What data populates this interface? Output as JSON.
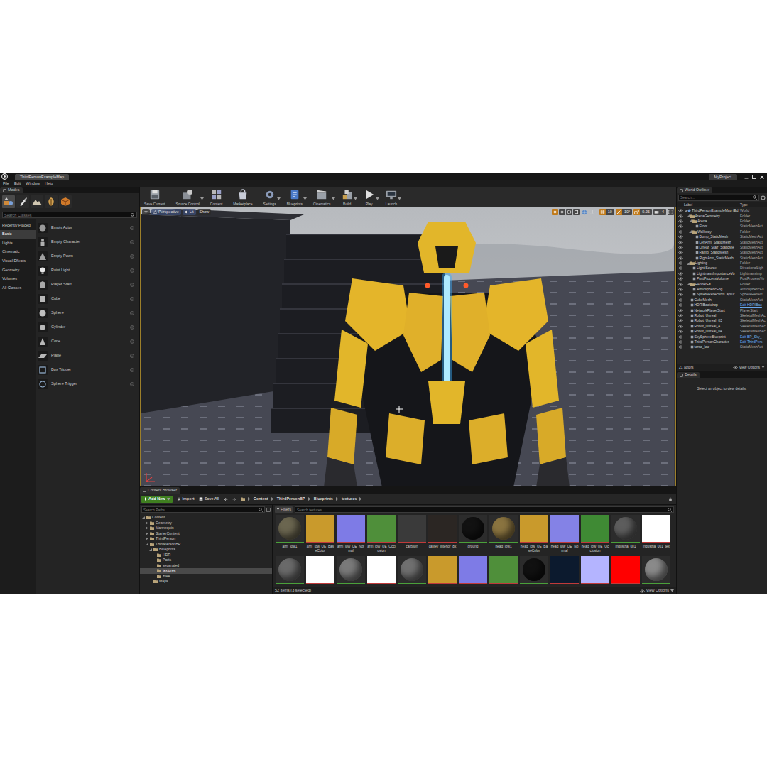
{
  "window": {
    "tab": "ThirdPersonExampleMap",
    "project": "MyProject"
  },
  "menu": [
    "File",
    "Edit",
    "Window",
    "Help"
  ],
  "modes": {
    "title": "Modes",
    "tools": [
      {
        "selected": true
      },
      {
        "selected": false
      },
      {
        "selected": false
      },
      {
        "selected": false
      },
      {
        "selected": false
      }
    ],
    "search": {
      "placeholder": "Search Classes"
    },
    "categories": [
      {
        "label": "Recently Placed",
        "selected": false
      },
      {
        "label": "Basic",
        "selected": true
      },
      {
        "label": "Lights",
        "selected": false
      },
      {
        "label": "Cinematic",
        "selected": false
      },
      {
        "label": "Visual Effects",
        "selected": false
      },
      {
        "label": "Geometry",
        "selected": false
      },
      {
        "label": "Volumes",
        "selected": false
      },
      {
        "label": "All Classes",
        "selected": false
      }
    ],
    "items": [
      "Empty Actor",
      "Empty Character",
      "Empty Pawn",
      "Point Light",
      "Player Start",
      "Cube",
      "Sphere",
      "Cylinder",
      "Cone",
      "Plane",
      "Box Trigger",
      "Sphere Trigger"
    ]
  },
  "toolbar": [
    {
      "label": "Save Current",
      "dropdown": false
    },
    {
      "label": "Source Control",
      "dropdown": true
    },
    {
      "label": "Content",
      "dropdown": false
    },
    {
      "label": "Marketplace",
      "dropdown": false
    },
    {
      "label": "Settings",
      "dropdown": true
    },
    {
      "label": "Blueprints",
      "dropdown": true
    },
    {
      "label": "Cinematics",
      "dropdown": true
    },
    {
      "label": "Build",
      "dropdown": true
    },
    {
      "label": "Play",
      "dropdown": true
    },
    {
      "label": "Launch",
      "dropdown": true
    }
  ],
  "viewport": {
    "view": "Perspective",
    "lighting": "Lit",
    "show": "Show",
    "transform_tools": [
      {
        "selected": true
      },
      {
        "selected": false
      },
      {
        "selected": false
      },
      {
        "selected": false
      }
    ],
    "snaps": [
      {
        "value": "10",
        "enabled": true
      },
      {
        "value": "10°",
        "enabled": true
      },
      {
        "value": "0.25",
        "enabled": true
      }
    ],
    "camera_speed": "4"
  },
  "outliner": {
    "title": "World Outliner",
    "search": {
      "placeholder": "Search..."
    },
    "columns": [
      "Label",
      "Type"
    ],
    "tree": [
      {
        "label": "ThirdPersonExampleMap (Ed",
        "type": "World",
        "kind": "world",
        "link": false,
        "expanded": true,
        "children": [
          {
            "label": "ArenaGeometry",
            "type": "Folder",
            "kind": "folder",
            "link": false,
            "expanded": true,
            "children": [
              {
                "label": "Arena",
                "type": "Folder",
                "kind": "folder",
                "link": false,
                "expanded": true,
                "children": [
                  {
                    "label": "Floor",
                    "type": "StaticMeshAct",
                    "kind": "actor",
                    "link": false,
                    "expanded": false,
                    "children": []
                  }
                ]
              },
              {
                "label": "Walkway",
                "type": "Folder",
                "kind": "folder",
                "link": false,
                "expanded": true,
                "children": [
                  {
                    "label": "Bump_StaticMesh",
                    "type": "StaticMeshAct",
                    "kind": "actor",
                    "link": false,
                    "expanded": false,
                    "children": []
                  },
                  {
                    "label": "LeftArm_StaticMesh",
                    "type": "StaticMeshAct",
                    "kind": "actor",
                    "link": false,
                    "expanded": false,
                    "children": []
                  },
                  {
                    "label": "Linear_Stair_StaticMe",
                    "type": "StaticMeshAct",
                    "kind": "actor",
                    "link": false,
                    "expanded": false,
                    "children": []
                  },
                  {
                    "label": "Ramp_StaticMesh",
                    "type": "StaticMeshAct",
                    "kind": "actor",
                    "link": false,
                    "expanded": false,
                    "children": []
                  },
                  {
                    "label": "RightArm_StaticMesh",
                    "type": "StaticMeshAct",
                    "kind": "actor",
                    "link": false,
                    "expanded": false,
                    "children": []
                  }
                ]
              }
            ]
          },
          {
            "label": "Lighting",
            "type": "Folder",
            "kind": "folder",
            "link": false,
            "expanded": true,
            "children": [
              {
                "label": "Light Source",
                "type": "DirectionalLigh",
                "kind": "actor",
                "link": false,
                "expanded": false,
                "children": []
              },
              {
                "label": "LightmassImportanceVo",
                "type": "Lightmassimp",
                "kind": "actor",
                "link": false,
                "expanded": false,
                "children": []
              },
              {
                "label": "PostProcessVolume",
                "type": "PostProcessVo",
                "kind": "actor",
                "link": false,
                "expanded": false,
                "children": []
              }
            ]
          },
          {
            "label": "RenderFX",
            "type": "Folder",
            "kind": "folder",
            "link": false,
            "expanded": true,
            "children": [
              {
                "label": "AtmosphericFog",
                "type": "AtmosphericFo",
                "kind": "actor",
                "link": false,
                "expanded": false,
                "children": []
              },
              {
                "label": "SphereReflectionCaptur",
                "type": "SphereReflect",
                "kind": "actor",
                "link": false,
                "expanded": false,
                "children": []
              }
            ]
          },
          {
            "label": "CubeMesh",
            "type": "StaticMeshAct",
            "kind": "actor",
            "link": false,
            "expanded": false,
            "children": []
          },
          {
            "label": "HDRIBackdrop",
            "type": "Edit HDRIBac",
            "kind": "actor",
            "link": true,
            "expanded": false,
            "children": []
          },
          {
            "label": "NetworkPlayerStart",
            "type": "PlayerStart",
            "kind": "actor",
            "link": false,
            "expanded": false,
            "children": []
          },
          {
            "label": "Robot_Unreal",
            "type": "SkeletalMeshAc",
            "kind": "actor",
            "link": false,
            "expanded": false,
            "children": []
          },
          {
            "label": "Robot_Unreal_03",
            "type": "SkeletalMeshAc",
            "kind": "actor",
            "link": false,
            "expanded": false,
            "children": []
          },
          {
            "label": "Robot_Unreal_4",
            "type": "SkeletalMeshAc",
            "kind": "actor",
            "link": false,
            "expanded": false,
            "children": []
          },
          {
            "label": "Robot_Unreal_04",
            "type": "SkeletalMeshAc",
            "kind": "actor",
            "link": false,
            "expanded": false,
            "children": []
          },
          {
            "label": "SkySphereBlueprint",
            "type": "Edit BP_Sky_",
            "kind": "actor",
            "link": true,
            "expanded": false,
            "children": []
          },
          {
            "label": "ThirdPersonCharacter",
            "type": "Edit ThirdPers",
            "kind": "actor",
            "link": true,
            "expanded": false,
            "children": []
          },
          {
            "label": "torso_low",
            "type": "StaticMeshAct",
            "kind": "actor",
            "link": false,
            "expanded": false,
            "children": []
          }
        ]
      }
    ],
    "footer": "21 actors",
    "view_options": "View Options"
  },
  "details": {
    "title": "Details",
    "empty": "Select an object to view details."
  },
  "content_browser": {
    "title": "Content Browser",
    "add_new": "Add New",
    "import": "Import",
    "save_all": "Save All",
    "path": [
      "Content",
      "ThirdPersonBP",
      "Blueprints",
      "textures"
    ],
    "search_paths": {
      "placeholder": "Search Paths"
    },
    "folders": [
      {
        "label": "Content",
        "expandable": true,
        "expanded": true,
        "selected": false,
        "children": [
          {
            "label": "Geometry",
            "expandable": true,
            "expanded": false,
            "selected": false,
            "children": []
          },
          {
            "label": "Mannequin",
            "expandable": true,
            "expanded": false,
            "selected": false,
            "children": []
          },
          {
            "label": "StarterContent",
            "expandable": true,
            "expanded": false,
            "selected": false,
            "children": []
          },
          {
            "label": "ThirdPerson",
            "expandable": true,
            "expanded": false,
            "selected": false,
            "children": []
          },
          {
            "label": "ThirdPersonBP",
            "expandable": true,
            "expanded": true,
            "selected": false,
            "children": [
              {
                "label": "Blueprints",
                "expandable": true,
                "expanded": true,
                "selected": false,
                "children": [
                  {
                    "label": "HDR",
                    "expandable": false,
                    "expanded": false,
                    "selected": false,
                    "children": []
                  },
                  {
                    "label": "Parts",
                    "expandable": false,
                    "expanded": false,
                    "selected": false,
                    "children": []
                  },
                  {
                    "label": "separated",
                    "expandable": false,
                    "expanded": false,
                    "selected": false,
                    "children": []
                  },
                  {
                    "label": "textures",
                    "expandable": false,
                    "expanded": false,
                    "selected": true,
                    "children": []
                  },
                  {
                    "label": "zilke",
                    "expandable": false,
                    "expanded": false,
                    "selected": false,
                    "children": []
                  }
                ]
              },
              {
                "label": "Maps",
                "expandable": false,
                "expanded": false,
                "selected": false,
                "children": []
              }
            ]
          }
        ]
      }
    ],
    "filters": "Filters",
    "search": {
      "placeholder": "Search textures"
    },
    "assets": [
      [
        {
          "label": "arm_low1",
          "kind": "material",
          "color": "#6b6650"
        },
        {
          "label": "arm_low_UE_BaseColor",
          "kind": "texture",
          "color": "#c99a2c"
        },
        {
          "label": "arm_low_UE_Normal",
          "kind": "texture",
          "color": "#7e7be6"
        },
        {
          "label": "arm_low_UE_Occlusion",
          "kind": "texture",
          "color": "#4f8f3a"
        },
        {
          "label": "carbiion",
          "kind": "texture",
          "color": "#3a3a3a"
        },
        {
          "label": "cayley_interior_8k",
          "kind": "texture",
          "color": "#2b2623"
        },
        {
          "label": "ground",
          "kind": "material",
          "color": "#121212"
        },
        {
          "label": "head_low1",
          "kind": "material",
          "color": "#8a7440"
        },
        {
          "label": "head_low_UE_BaseColor",
          "kind": "texture",
          "color": "#c99a2c"
        },
        {
          "label": "head_low_UE_Normal",
          "kind": "texture",
          "color": "#8482e6"
        },
        {
          "label": "head_low_UE_Occlusion",
          "kind": "texture",
          "color": "#3f8a34"
        },
        {
          "label": "industria_001",
          "kind": "material",
          "color": "#5d5d5d"
        },
        {
          "label": "industria_001_tex",
          "kind": "texture",
          "color": "#ffffff"
        }
      ],
      [
        {
          "kind": "material",
          "color": "#6a6a6a"
        },
        {
          "kind": "texture",
          "color": "#ffffff"
        },
        {
          "kind": "material",
          "color": "#7a7a7a"
        },
        {
          "kind": "texture",
          "color": "#ffffff"
        },
        {
          "kind": "material",
          "color": "#707070"
        },
        {
          "kind": "texture",
          "color": "#c99a2c"
        },
        {
          "kind": "texture",
          "color": "#7e7be6"
        },
        {
          "kind": "texture",
          "color": "#4f8f3a"
        },
        {
          "kind": "material",
          "color": "#111111"
        },
        {
          "kind": "texture",
          "color": "#0c1a2e"
        },
        {
          "kind": "texture",
          "color": "#b4b4ff"
        },
        {
          "kind": "texture",
          "color": "#ff0000"
        },
        {
          "kind": "material",
          "color": "#8a8a8a"
        }
      ]
    ],
    "footer": "52 items (3 selected)",
    "view_options": "View Options"
  }
}
